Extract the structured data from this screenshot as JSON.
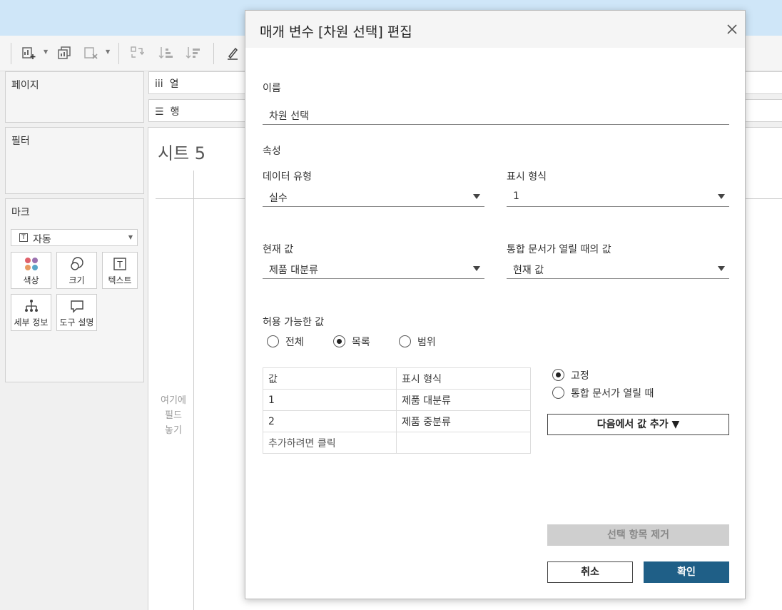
{
  "toolbar": {
    "icons": [
      "new-worksheet-icon",
      "duplicate-icon",
      "clear-sheet-icon",
      "swap-icon",
      "sort-ascending-icon",
      "sort-descending-icon",
      "highlight-icon"
    ]
  },
  "pages_panel": {
    "title": "페이지"
  },
  "filters_panel": {
    "title": "필터"
  },
  "marks_panel": {
    "title": "마크",
    "type_select": "자동",
    "cards": [
      {
        "label": "색상",
        "icon": "color-dots-icon"
      },
      {
        "label": "크기",
        "icon": "size-icon"
      },
      {
        "label": "텍스트",
        "icon": "text-icon"
      },
      {
        "label": "세부 정보",
        "icon": "detail-icon"
      },
      {
        "label": "도구 설명",
        "icon": "tooltip-icon"
      }
    ]
  },
  "shelves": {
    "columns": {
      "icon_text": "iii",
      "label": "열"
    },
    "rows": {
      "icon_text": "☰",
      "label": "행"
    }
  },
  "sheet": {
    "title": "시트 5",
    "drop_hint_lines": [
      "여기에",
      "필드",
      "놓기"
    ]
  },
  "dialog": {
    "title": "매개 변수 [차원 선택] 편집",
    "name_label": "이름",
    "name_value": "차원 선택",
    "properties_label": "속성",
    "data_type_label": "데이터 유형",
    "data_type_value": "실수",
    "display_format_label": "표시 형식",
    "display_format_value": "1",
    "current_value_label": "현재 값",
    "current_value_value": "제품 대분류",
    "on_open_label": "통합 문서가 열릴 때의 값",
    "on_open_value": "현재 값",
    "allowable_label": "허용 가능한 값",
    "allowable_options": [
      "전체",
      "목록",
      "범위"
    ],
    "allowable_selected": "목록",
    "table": {
      "headers": [
        "값",
        "표시 형식"
      ],
      "rows": [
        {
          "value": "1",
          "display": "제품 대분류"
        },
        {
          "value": "2",
          "display": "제품 중분류"
        }
      ],
      "add_row_text": "추가하려면 클릭"
    },
    "list_mode_options": [
      "고정",
      "통합 문서가 열릴 때"
    ],
    "list_mode_selected": "고정",
    "add_from_button": "다음에서 값 추가 ▼",
    "remove_button": "선택 항목 제거",
    "cancel_button": "취소",
    "ok_button": "확인"
  },
  "colors": {
    "topbar": "#cfe6f8",
    "primary_button": "#1f5f87",
    "disabled_button": "#cfcfcf",
    "dots": [
      "#e0616b",
      "#9b72b0",
      "#e89a61",
      "#59a6c9"
    ]
  }
}
